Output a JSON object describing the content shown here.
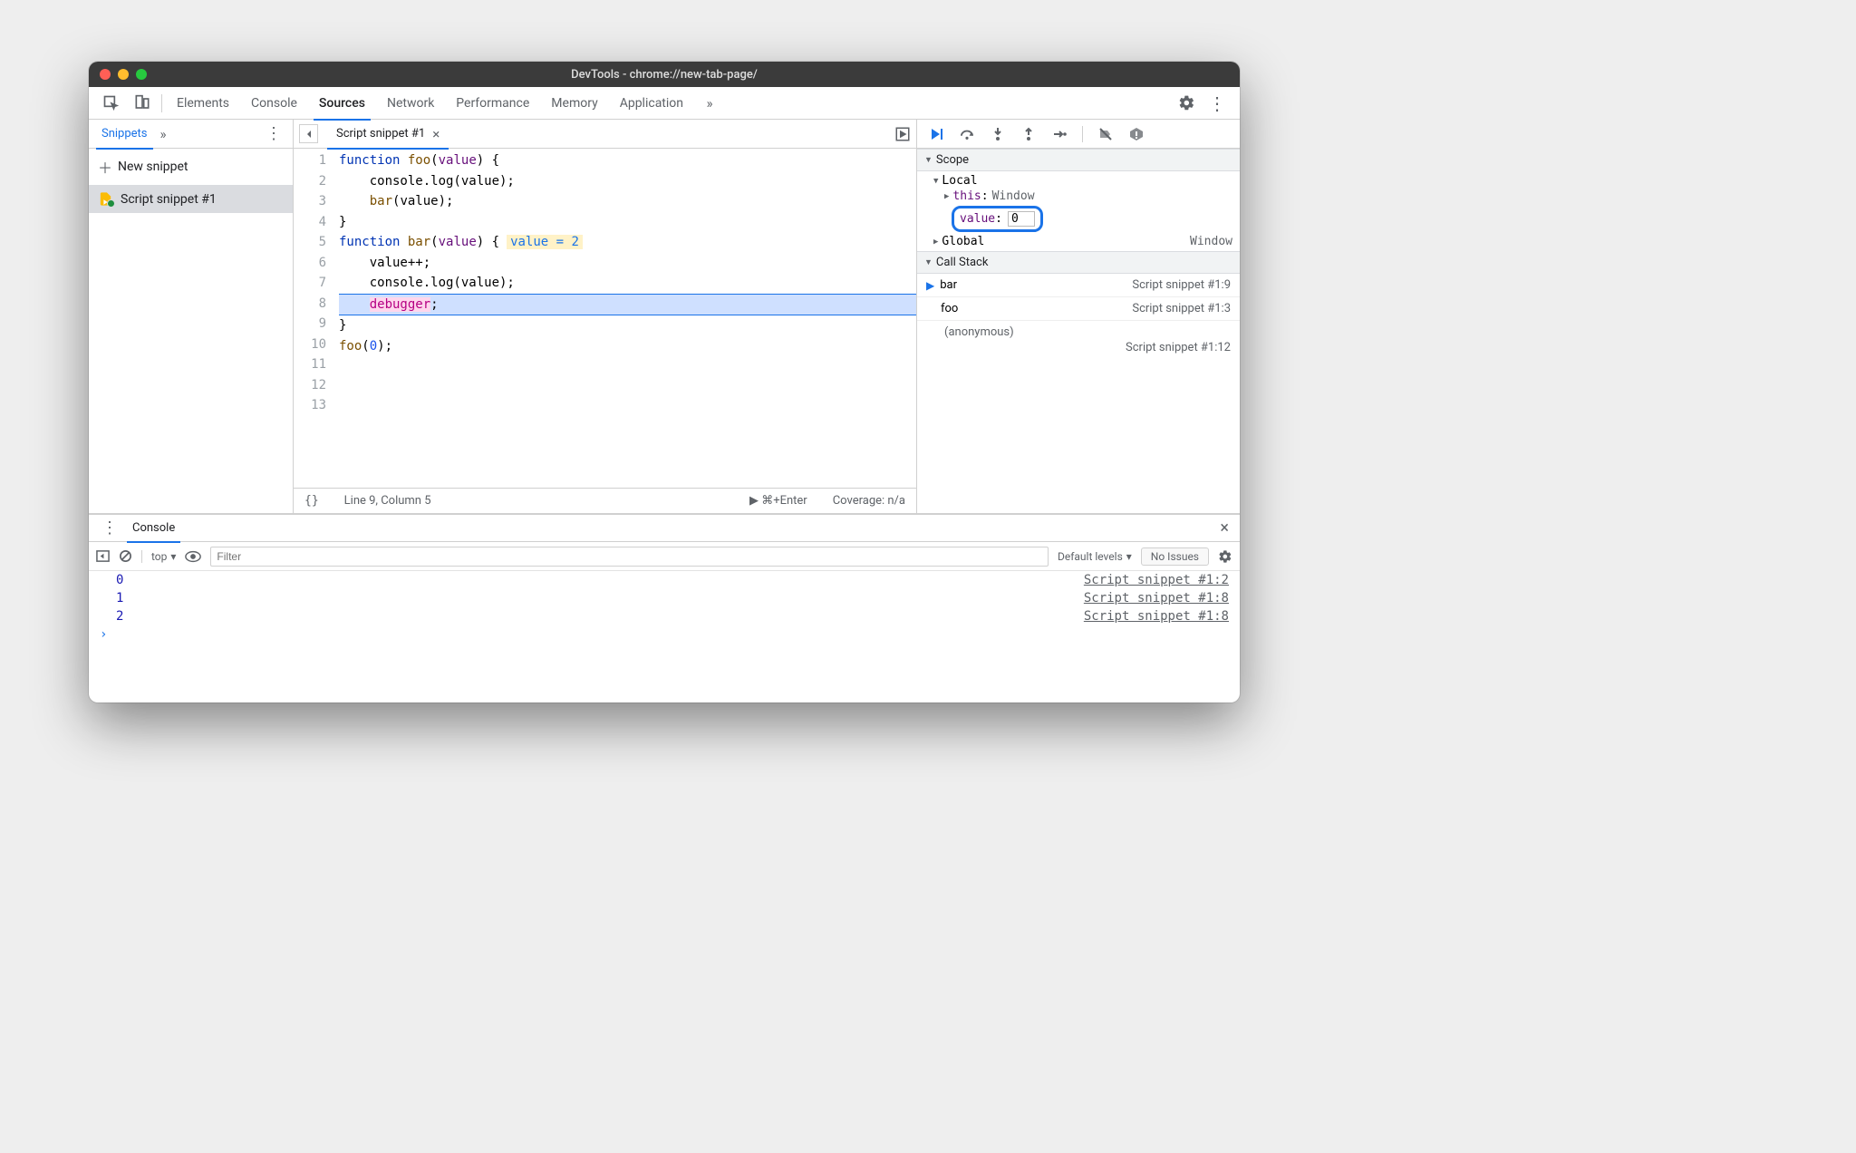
{
  "window": {
    "title": "DevTools - chrome://new-tab-page/"
  },
  "tabs": {
    "elements": "Elements",
    "console": "Console",
    "sources": "Sources",
    "network": "Network",
    "performance": "Performance",
    "memory": "Memory",
    "application": "Application"
  },
  "navigator": {
    "snippets_tab": "Snippets",
    "new_snippet": "New snippet",
    "items": [
      {
        "name": "Script snippet #1"
      }
    ]
  },
  "editor": {
    "filename": "Script snippet #1",
    "lines": {
      "l1a": "function",
      "l1b": "foo",
      "l1c": "(",
      "l1d": "value",
      "l1e": ") {",
      "l2": "    console.log(value);",
      "l3a": "    ",
      "l3b": "bar",
      "l3c": "(value);",
      "l4": "}",
      "l5": "",
      "l6a": "function",
      "l6b": "bar",
      "l6c": "(",
      "l6d": "value",
      "l6e": ") {",
      "l6_inline": "value = 2",
      "l7": "    value++;",
      "l8": "    console.log(value);",
      "l9a": "    ",
      "l9b": "debugger",
      "l9c": ";",
      "l10": "}",
      "l11": "",
      "l12a": "foo",
      "l12b": "(",
      "l12c": "0",
      "l12d": ");",
      "l13": ""
    },
    "line_numbers": [
      "1",
      "2",
      "3",
      "4",
      "5",
      "6",
      "7",
      "8",
      "9",
      "10",
      "11",
      "12",
      "13"
    ],
    "status": {
      "pretty": "{}",
      "cursor": "Line 9, Column 5",
      "run_hint": "▶ ⌘+Enter",
      "coverage": "Coverage: n/a"
    }
  },
  "scope": {
    "header": "Scope",
    "local": "Local",
    "this_label": "this",
    "this_value": "Window",
    "value_label": "value",
    "value_edit": "0",
    "global": "Global",
    "global_value": "Window"
  },
  "callstack": {
    "header": "Call Stack",
    "frames": [
      {
        "fn": "bar",
        "loc": "Script snippet #1:9"
      },
      {
        "fn": "foo",
        "loc": "Script snippet #1:3"
      }
    ],
    "anon": "(anonymous)",
    "anon_loc": "Script snippet #1:12"
  },
  "drawer": {
    "console_tab": "Console",
    "context": "top",
    "filter_placeholder": "Filter",
    "levels": "Default levels",
    "issues": "No Issues",
    "log": [
      {
        "value": "0",
        "link": "Script snippet #1:2"
      },
      {
        "value": "1",
        "link": "Script snippet #1:8"
      },
      {
        "value": "2",
        "link": "Script snippet #1:8"
      }
    ]
  }
}
